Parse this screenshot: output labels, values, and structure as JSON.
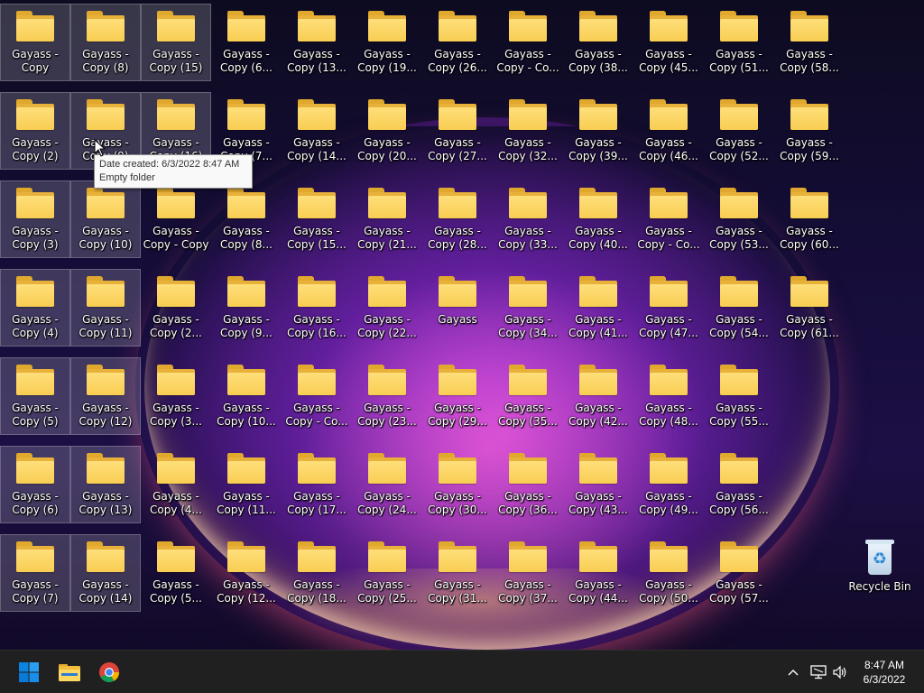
{
  "desktop": {
    "columns": [
      [
        {
          "label": "Gayass -\nCopy",
          "selected": true
        },
        {
          "label": "Gayass -\nCopy (2)",
          "selected": true
        },
        {
          "label": "Gayass -\nCopy (3)",
          "selected": true
        },
        {
          "label": "Gayass -\nCopy (4)",
          "selected": true
        },
        {
          "label": "Gayass -\nCopy (5)",
          "selected": true
        },
        {
          "label": "Gayass -\nCopy (6)",
          "selected": true
        },
        {
          "label": "Gayass -\nCopy (7)",
          "selected": true
        }
      ],
      [
        {
          "label": "Gayass -\nCopy (8)",
          "selected": true
        },
        {
          "label": "Gayass -\nCopy (9)",
          "selected": true
        },
        {
          "label": "Gayass -\nCopy (10)",
          "selected": true
        },
        {
          "label": "Gayass -\nCopy (11)",
          "selected": true
        },
        {
          "label": "Gayass -\nCopy (12)",
          "selected": true
        },
        {
          "label": "Gayass -\nCopy (13)",
          "selected": true
        },
        {
          "label": "Gayass -\nCopy (14)",
          "selected": true
        }
      ],
      [
        {
          "label": "Gayass -\nCopy (15)",
          "selected": true
        },
        {
          "label": "Gayass -\nCopy (16)",
          "selected": true
        },
        {
          "label": "Gayass -\nCopy - Copy",
          "selected": false
        },
        {
          "label": "Gayass -\nCopy (2...",
          "selected": false
        },
        {
          "label": "Gayass -\nCopy (3...",
          "selected": false
        },
        {
          "label": "Gayass -\nCopy (4...",
          "selected": false
        },
        {
          "label": "Gayass -\nCopy (5...",
          "selected": false
        }
      ],
      [
        {
          "label": "Gayass -\nCopy (6...",
          "selected": false
        },
        {
          "label": "Gayass -\nCopy (7...",
          "selected": false
        },
        {
          "label": "Gayass -\nCopy (8...",
          "selected": false
        },
        {
          "label": "Gayass -\nCopy (9...",
          "selected": false
        },
        {
          "label": "Gayass -\nCopy (10...",
          "selected": false
        },
        {
          "label": "Gayass -\nCopy (11...",
          "selected": false
        },
        {
          "label": "Gayass -\nCopy (12...",
          "selected": false
        }
      ],
      [
        {
          "label": "Gayass -\nCopy (13...",
          "selected": false
        },
        {
          "label": "Gayass -\nCopy (14...",
          "selected": false
        },
        {
          "label": "Gayass -\nCopy (15...",
          "selected": false
        },
        {
          "label": "Gayass -\nCopy (16...",
          "selected": false
        },
        {
          "label": "Gayass -\nCopy - Co...",
          "selected": false
        },
        {
          "label": "Gayass -\nCopy (17...",
          "selected": false
        },
        {
          "label": "Gayass -\nCopy (18...",
          "selected": false
        }
      ],
      [
        {
          "label": "Gayass -\nCopy (19...",
          "selected": false
        },
        {
          "label": "Gayass -\nCopy (20...",
          "selected": false
        },
        {
          "label": "Gayass -\nCopy (21...",
          "selected": false
        },
        {
          "label": "Gayass -\nCopy (22...",
          "selected": false
        },
        {
          "label": "Gayass -\nCopy (23...",
          "selected": false
        },
        {
          "label": "Gayass -\nCopy (24...",
          "selected": false
        },
        {
          "label": "Gayass -\nCopy (25...",
          "selected": false
        }
      ],
      [
        {
          "label": "Gayass -\nCopy (26...",
          "selected": false
        },
        {
          "label": "Gayass -\nCopy (27...",
          "selected": false
        },
        {
          "label": "Gayass -\nCopy (28...",
          "selected": false
        },
        {
          "label": "Gayass",
          "selected": false
        },
        {
          "label": "Gayass -\nCopy (29...",
          "selected": false
        },
        {
          "label": "Gayass -\nCopy (30...",
          "selected": false
        },
        {
          "label": "Gayass -\nCopy (31...",
          "selected": false
        }
      ],
      [
        {
          "label": "Gayass -\nCopy - Co...",
          "selected": false
        },
        {
          "label": "Gayass -\nCopy (32...",
          "selected": false
        },
        {
          "label": "Gayass -\nCopy (33...",
          "selected": false
        },
        {
          "label": "Gayass -\nCopy (34...",
          "selected": false
        },
        {
          "label": "Gayass -\nCopy (35...",
          "selected": false
        },
        {
          "label": "Gayass -\nCopy (36...",
          "selected": false
        },
        {
          "label": "Gayass -\nCopy (37...",
          "selected": false
        }
      ],
      [
        {
          "label": "Gayass -\nCopy (38...",
          "selected": false
        },
        {
          "label": "Gayass -\nCopy (39...",
          "selected": false
        },
        {
          "label": "Gayass -\nCopy (40...",
          "selected": false
        },
        {
          "label": "Gayass -\nCopy (41...",
          "selected": false
        },
        {
          "label": "Gayass -\nCopy (42...",
          "selected": false
        },
        {
          "label": "Gayass -\nCopy (43...",
          "selected": false
        },
        {
          "label": "Gayass -\nCopy (44...",
          "selected": false
        }
      ],
      [
        {
          "label": "Gayass -\nCopy (45...",
          "selected": false
        },
        {
          "label": "Gayass -\nCopy (46...",
          "selected": false
        },
        {
          "label": "Gayass -\nCopy - Co...",
          "selected": false
        },
        {
          "label": "Gayass -\nCopy (47...",
          "selected": false
        },
        {
          "label": "Gayass -\nCopy (48...",
          "selected": false
        },
        {
          "label": "Gayass -\nCopy (49...",
          "selected": false
        },
        {
          "label": "Gayass -\nCopy (50...",
          "selected": false
        }
      ],
      [
        {
          "label": "Gayass -\nCopy (51...",
          "selected": false
        },
        {
          "label": "Gayass -\nCopy (52...",
          "selected": false
        },
        {
          "label": "Gayass -\nCopy (53...",
          "selected": false
        },
        {
          "label": "Gayass -\nCopy (54...",
          "selected": false
        },
        {
          "label": "Gayass -\nCopy (55...",
          "selected": false
        },
        {
          "label": "Gayass -\nCopy (56...",
          "selected": false
        },
        {
          "label": "Gayass -\nCopy (57...",
          "selected": false
        }
      ],
      [
        {
          "label": "Gayass -\nCopy (58...",
          "selected": false
        },
        {
          "label": "Gayass -\nCopy (59...",
          "selected": false
        },
        {
          "label": "Gayass -\nCopy (60...",
          "selected": false
        },
        {
          "label": "Gayass -\nCopy (61...",
          "selected": false
        }
      ]
    ],
    "recycle_bin": {
      "label": "Recycle Bin"
    }
  },
  "tooltip": {
    "line1": "Date created: 6/3/2022 8:47 AM",
    "line2": "Empty folder"
  },
  "taskbar": {
    "pinned": [
      {
        "name": "start-button",
        "icon": "windows-logo-icon"
      },
      {
        "name": "file-explorer-button",
        "icon": "folder-icon"
      },
      {
        "name": "chrome-button",
        "icon": "chrome-icon"
      }
    ],
    "tray_icons": [
      "chevron-up-icon",
      "network-icon",
      "speaker-icon"
    ],
    "clock": {
      "time": "8:47 AM",
      "date": "6/3/2022"
    }
  },
  "colors": {
    "taskbar_bg": "#202020",
    "folder_yellow": "#f8cd52",
    "selection": "rgba(255,255,255,0.18)",
    "windows_blue": "#0078d4"
  }
}
